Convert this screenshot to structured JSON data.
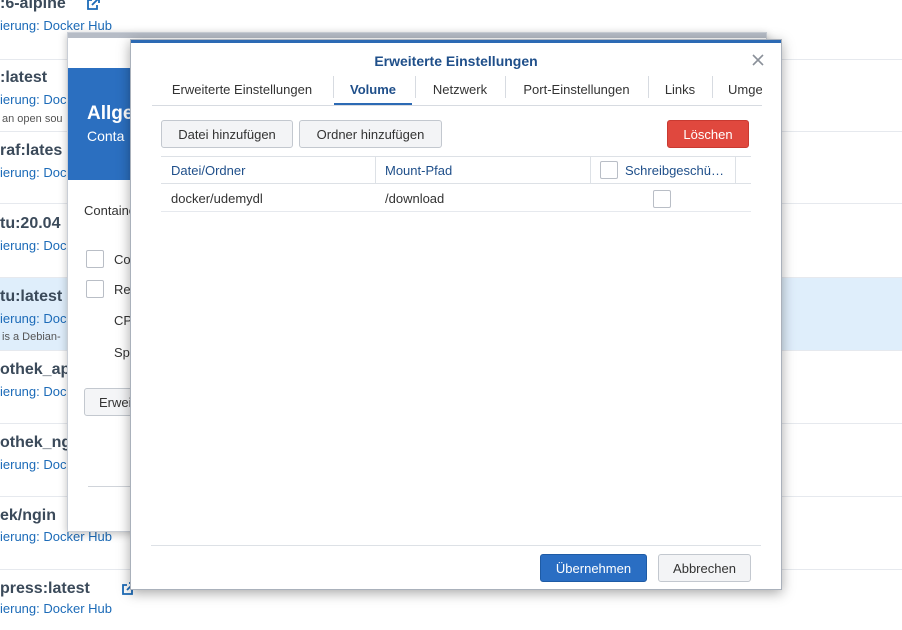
{
  "background_list": {
    "items": [
      {
        "name": ":6-alpine",
        "source": "ierung: Docker Hub",
        "description": "",
        "has_external_link": true,
        "selected": false
      },
      {
        "name": ":latest",
        "source": "ierung: Doc",
        "description": "an open sou",
        "has_external_link": false,
        "selected": false
      },
      {
        "name": "raf:lates",
        "source": "ierung: Doc",
        "description": "",
        "has_external_link": false,
        "selected": false
      },
      {
        "name": "tu:20.04",
        "source": "ierung: Doc",
        "description": "",
        "has_external_link": false,
        "selected": false
      },
      {
        "name": "tu:latest",
        "source": "ierung: Doc",
        "description": "is a Debian-",
        "has_external_link": false,
        "selected": true
      },
      {
        "name": "othek_ap",
        "source": "ierung: Doc",
        "description": "",
        "has_external_link": false,
        "selected": false
      },
      {
        "name": "othek_ng",
        "source": "ierung: Doc",
        "description": "",
        "has_external_link": false,
        "selected": false
      },
      {
        "name": "ek/ngin",
        "source": "ierung: Docker Hub",
        "description": "",
        "has_external_link": false,
        "selected": false
      },
      {
        "name": "press:latest",
        "source": "ierung: Docker Hub",
        "description": "",
        "has_external_link": true,
        "selected": false
      }
    ]
  },
  "middle_dialog": {
    "banner_title": "Allge",
    "banner_subtitle": "Conta",
    "container_label": "Containe",
    "option_1": "Co",
    "option_2": "Res",
    "cpu_label": "CP",
    "memory_label": "Spe",
    "advanced_button": "Erwei"
  },
  "dialog": {
    "title": "Erweiterte Einstellungen",
    "tabs": [
      {
        "label": "Erweiterte Einstellungen",
        "active": false
      },
      {
        "label": "Volume",
        "active": true
      },
      {
        "label": "Netzwerk",
        "active": false
      },
      {
        "label": "Port-Einstellungen",
        "active": false
      },
      {
        "label": "Links",
        "active": false
      },
      {
        "label": "Umge",
        "active": false
      }
    ],
    "toolbar": {
      "add_file": "Datei hinzufügen",
      "add_folder": "Ordner hinzufügen",
      "delete": "Löschen"
    },
    "table": {
      "columns": [
        "Datei/Ordner",
        "Mount-Pfad",
        "Schreibgeschü…"
      ],
      "rows": [
        {
          "file_folder": "docker/udemydl",
          "mount_path": "/download",
          "read_only": false
        }
      ]
    },
    "footer": {
      "apply": "Übernehmen",
      "cancel": "Abbrechen"
    }
  },
  "colors": {
    "accent": "#2c6ab4",
    "danger": "#e0483e",
    "link": "#1c6bb8",
    "selected_row": "#dfeefb"
  }
}
